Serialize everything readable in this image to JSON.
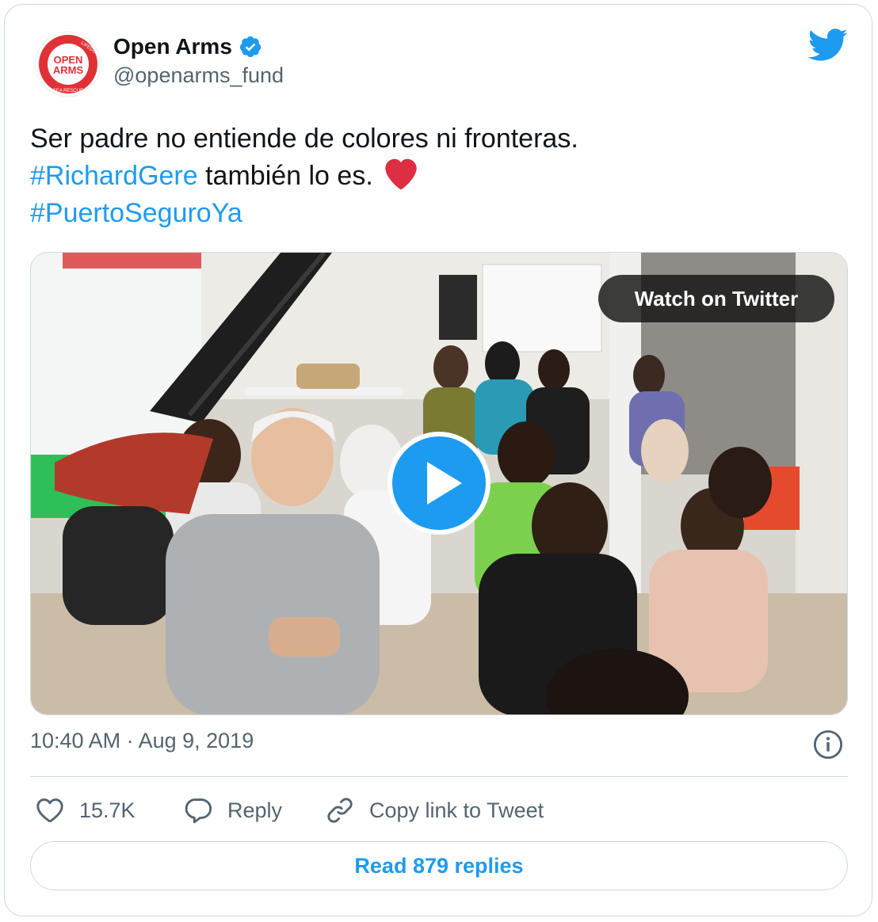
{
  "account": {
    "name": "Open Arms",
    "handle": "@openarms_fund",
    "verified": true,
    "avatar": {
      "ring_top": "LIFEGUARD",
      "ring_bottom": "SEA RESCUE",
      "logo_line1": "OPEN",
      "logo_line2": "ARMS"
    }
  },
  "tweet": {
    "line1": "Ser padre no entiende de colores ni fronteras.",
    "hashtag1": "#RichardGere",
    "line2_rest": " también lo es.",
    "emoji": "red-heart",
    "hashtag2": "#PuertoSeguroYa"
  },
  "media": {
    "watch_label": "Watch on Twitter"
  },
  "meta": {
    "timestamp": "10:40 AM · Aug 9, 2019"
  },
  "actions": {
    "like_count": "15.7K",
    "reply_label": "Reply",
    "copy_link_label": "Copy link to Tweet"
  },
  "read_replies": "Read 879 replies",
  "colors": {
    "accent": "#1d9bf0",
    "text": "#0f1419",
    "secondary": "#536471",
    "border": "#cfd9de",
    "heart": "#e0245e",
    "brand_red": "#e03236"
  },
  "icons": [
    "twitter-logo-icon",
    "verified-badge-icon",
    "play-icon",
    "info-icon",
    "heart-icon",
    "reply-bubble-icon",
    "link-icon"
  ]
}
